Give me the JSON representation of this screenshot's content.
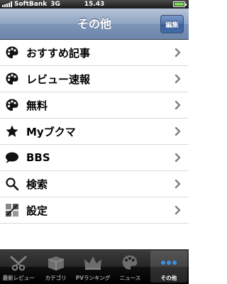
{
  "status_bar": {
    "carrier": "SoftBank",
    "network": "3G",
    "time": "15.43"
  },
  "nav": {
    "title": "その他",
    "edit_label": "編集"
  },
  "menu": {
    "items": [
      {
        "label": "おすすめ記事",
        "icon": "palette-icon"
      },
      {
        "label": "レビュー速報",
        "icon": "palette-icon"
      },
      {
        "label": "無料",
        "icon": "palette-icon"
      },
      {
        "label": "Myブクマ",
        "icon": "star-icon"
      },
      {
        "label": "BBS",
        "icon": "speech-bubble-icon"
      },
      {
        "label": "検索",
        "icon": "magnifier-icon"
      },
      {
        "label": "設定",
        "icon": "settings-tiles-icon"
      }
    ]
  },
  "tabs": [
    {
      "label": "最新レビュー",
      "icon": "scissors-icon",
      "active": false
    },
    {
      "label": "カテゴリ",
      "icon": "box-icon",
      "active": false
    },
    {
      "label": "PVランキング",
      "icon": "crown-icon",
      "active": false
    },
    {
      "label": "ニュース",
      "icon": "palette-icon",
      "active": false
    },
    {
      "label": "その他",
      "icon": "more-dots-icon",
      "active": true
    }
  ],
  "colors": {
    "battery": "#7ae050",
    "nav_bar": "#7d94b6",
    "edit_button": "#4f72ad",
    "tab_active_icon": "#3f8fe0"
  }
}
